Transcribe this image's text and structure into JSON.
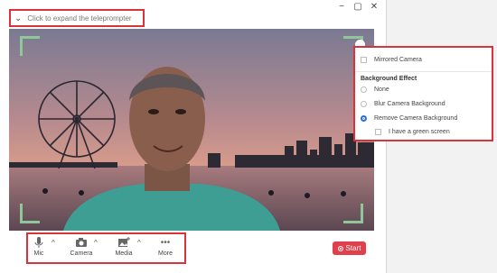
{
  "teleprompter": {
    "label": "Click to expand the teleprompter"
  },
  "window_controls": [
    "−",
    "▢",
    "✕"
  ],
  "toolbar": {
    "mic_label": "Mic",
    "camera_label": "Camera",
    "media_label": "Media",
    "more_label": "More",
    "start_label": "Start"
  },
  "camera_menu": {
    "mirrored_label": "Mirrored Camera",
    "section_title": "Background Effect",
    "options": [
      "None",
      "Blur Camera Background",
      "Remove Camera Background"
    ],
    "selected": "Remove Camera Background",
    "green_screen_label": "I have a green screen"
  },
  "colors": {
    "highlight": "#d9323c",
    "accent": "#e0404b",
    "frame": "#8fc79a",
    "radio_selected": "#2a6fdb"
  }
}
